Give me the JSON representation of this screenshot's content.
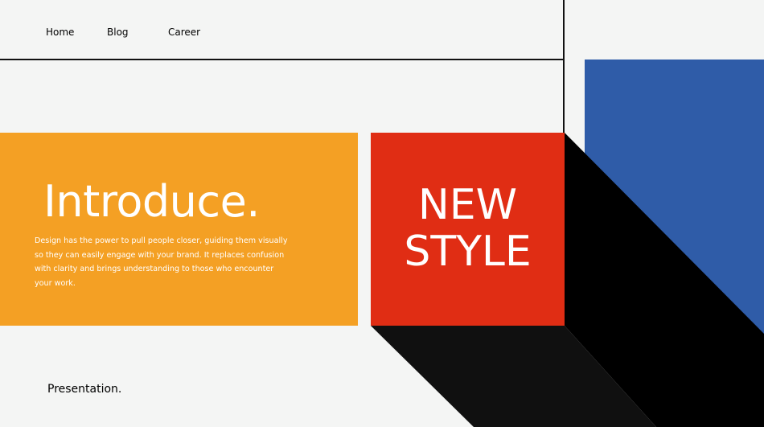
{
  "nav": {
    "home": "Home",
    "blog": "Blog",
    "career": "Career"
  },
  "intro": {
    "title": "Introduce.",
    "body": "Design has the power to pull people closer, guiding them visually so they can easily engage with your brand. It replaces confusion with clarity and brings understanding to those who encounter your work."
  },
  "headline": {
    "line1": "NEW",
    "line2": "STYLE"
  },
  "footer": {
    "label": "Presentation."
  },
  "colors": {
    "background": "#f4f5f4",
    "orange": "#f4a024",
    "red": "#e02d14",
    "blue": "#2f5ca8",
    "shadow": "#000000"
  }
}
